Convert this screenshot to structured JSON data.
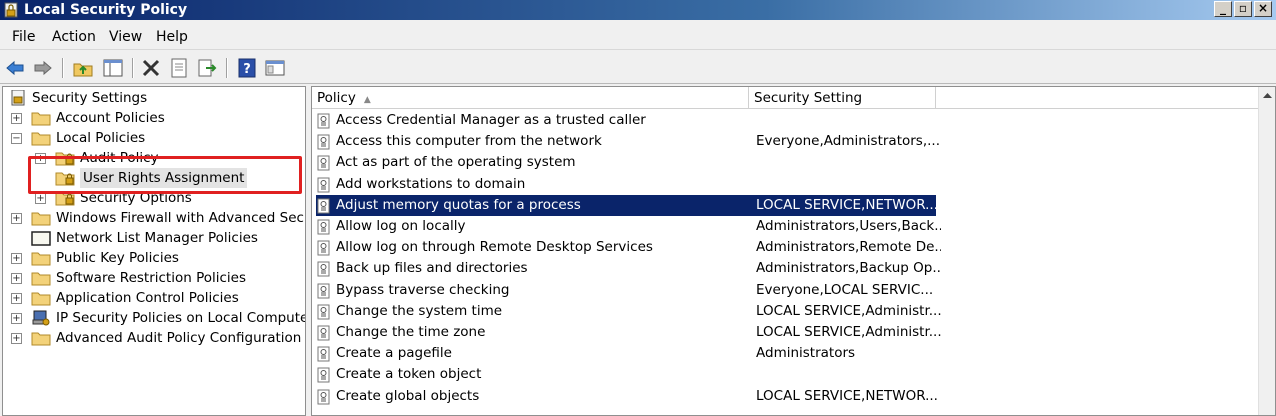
{
  "window": {
    "title": "Local Security Policy",
    "buttons": [
      "_",
      "▫",
      "×"
    ]
  },
  "menubar": {
    "items": [
      "File",
      "Action",
      "View",
      "Help"
    ]
  },
  "toolbar": {
    "icons": [
      "back-arrow-icon",
      "forward-arrow-icon",
      "up-folder-icon",
      "show-hide-tree-icon",
      "delete-icon",
      "properties-icon",
      "export-list-icon",
      "help-icon",
      "console-icon"
    ]
  },
  "tree": {
    "root": "Security Settings",
    "items": [
      {
        "label": "Account Policies",
        "expander": "+"
      },
      {
        "label": "Local Policies",
        "expander": "−"
      },
      {
        "label": "Audit Policy",
        "expander": "+"
      },
      {
        "label": "User Rights Assignment",
        "expander": ""
      },
      {
        "label": "Security Options",
        "expander": "+"
      },
      {
        "label": "Windows Firewall with Advanced Security",
        "expander": "+"
      },
      {
        "label": "Network List Manager Policies",
        "expander": ""
      },
      {
        "label": "Public Key Policies",
        "expander": "+"
      },
      {
        "label": "Software Restriction Policies",
        "expander": "+"
      },
      {
        "label": "Application Control Policies",
        "expander": "+"
      },
      {
        "label": "IP Security Policies on Local Computer",
        "expander": "+"
      },
      {
        "label": "Advanced Audit Policy Configuration",
        "expander": "+"
      }
    ]
  },
  "list": {
    "columns": [
      "Policy",
      "Security Setting"
    ],
    "rows": [
      {
        "policy": "Access Credential Manager as a trusted caller",
        "setting": ""
      },
      {
        "policy": "Access this computer from the network",
        "setting": "Everyone,Administrators,..."
      },
      {
        "policy": "Act as part of the operating system",
        "setting": ""
      },
      {
        "policy": "Add workstations to domain",
        "setting": ""
      },
      {
        "policy": "Adjust memory quotas for a process",
        "setting": "LOCAL SERVICE,NETWOR..."
      },
      {
        "policy": "Allow log on locally",
        "setting": "Administrators,Users,Back..."
      },
      {
        "policy": "Allow log on through Remote Desktop Services",
        "setting": "Administrators,Remote De..."
      },
      {
        "policy": "Back up files and directories",
        "setting": "Administrators,Backup Op..."
      },
      {
        "policy": "Bypass traverse checking",
        "setting": "Everyone,LOCAL SERVIC..."
      },
      {
        "policy": "Change the system time",
        "setting": "LOCAL SERVICE,Administr..."
      },
      {
        "policy": "Change the time zone",
        "setting": "LOCAL SERVICE,Administr..."
      },
      {
        "policy": "Create a pagefile",
        "setting": "Administrators"
      },
      {
        "policy": "Create a token object",
        "setting": ""
      },
      {
        "policy": "Create global objects",
        "setting": "LOCAL SERVICE,NETWOR..."
      }
    ]
  }
}
